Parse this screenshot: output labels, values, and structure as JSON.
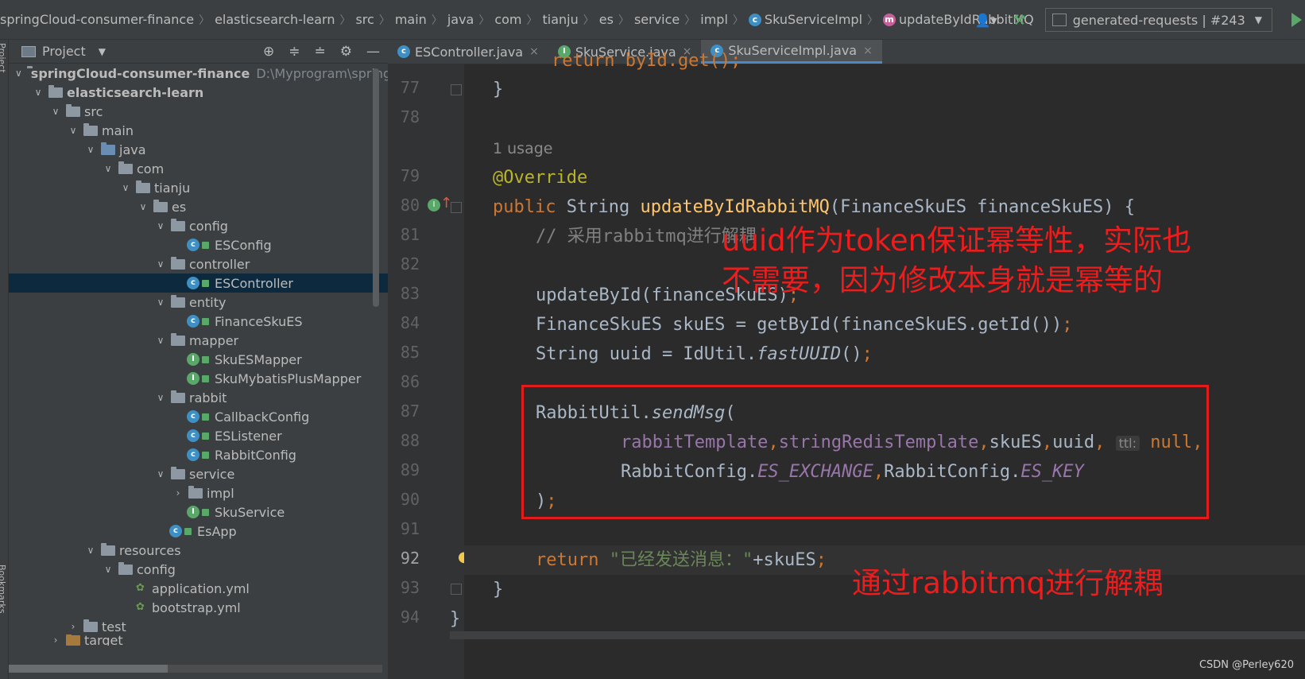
{
  "breadcrumbs": [
    "springCloud-consumer-finance",
    "elasticsearch-learn",
    "src",
    "main",
    "java",
    "com",
    "tianju",
    "es",
    "service",
    "impl",
    "SkuServiceImpl",
    "updateByIdRabbitMQ"
  ],
  "toolbar": {
    "run_config": "generated-requests | #243"
  },
  "left_stripe": {
    "project": "Project",
    "bookmarks": "Bookmarks"
  },
  "project_panel": {
    "title": "Project",
    "tree": [
      {
        "label": "springCloud-consumer-finance",
        "hint": "D:\\Myprogram\\springCl"
      },
      {
        "label": "elasticsearch-learn"
      },
      {
        "label": "src"
      },
      {
        "label": "main"
      },
      {
        "label": "java"
      },
      {
        "label": "com"
      },
      {
        "label": "tianju"
      },
      {
        "label": "es"
      },
      {
        "label": "config"
      },
      {
        "label": "ESConfig"
      },
      {
        "label": "controller"
      },
      {
        "label": "ESController"
      },
      {
        "label": "entity"
      },
      {
        "label": "FinanceSkuES"
      },
      {
        "label": "mapper"
      },
      {
        "label": "SkuESMapper"
      },
      {
        "label": "SkuMybatisPlusMapper"
      },
      {
        "label": "rabbit"
      },
      {
        "label": "CallbackConfig"
      },
      {
        "label": "ESListener"
      },
      {
        "label": "RabbitConfig"
      },
      {
        "label": "service"
      },
      {
        "label": "impl"
      },
      {
        "label": "SkuService"
      },
      {
        "label": "EsApp"
      },
      {
        "label": "resources"
      },
      {
        "label": "config"
      },
      {
        "label": "application.yml"
      },
      {
        "label": "bootstrap.yml"
      },
      {
        "label": "test"
      },
      {
        "label": "target"
      }
    ]
  },
  "tabs": [
    {
      "label": "ESController.java",
      "active": false
    },
    {
      "label": "SkuService.java",
      "active": false
    },
    {
      "label": "SkuServiceImpl.java",
      "active": true
    }
  ],
  "line_numbers": [
    "77",
    "78",
    "79",
    "80",
    "81",
    "82",
    "83",
    "84",
    "85",
    "86",
    "87",
    "88",
    "89",
    "90",
    "91",
    "92",
    "93",
    "94"
  ],
  "code": {
    "l76": "return byId.get();",
    "l77": "}",
    "usage": "1 usage",
    "l79": "@Override",
    "l80_kw": "public",
    "l80_type": " String ",
    "l80_fn": "updateByIdRabbitMQ",
    "l80_rest": "(FinanceSkuES financeSkuES) {",
    "l81": "// 采用rabbitmq进行解耦",
    "l83": "updateById(financeSkuES)",
    "l83_end": ";",
    "l84_a": "FinanceSkuES skuES = getById(financeSkuES.getId())",
    "l84_end": ";",
    "l85_a": "String uuid = IdUtil.",
    "l85_fn": "fastUUID",
    "l85_b": "()",
    "l85_end": ";",
    "l87_a": "RabbitUtil.",
    "l87_fn": "sendMsg",
    "l87_b": "(",
    "l88_f1": "rabbitTemplate",
    "l88_c1": ",",
    "l88_f2": "stringRedisTemplate",
    "l88_c2": ",",
    "l88_v": "skuES",
    "l88_c3": ",",
    "l88_v2": "uuid",
    "l88_c4": ",",
    "l88_hint": "ttl:",
    "l88_null": "null",
    "l88_c5": ",",
    "l89_a": "RabbitConfig.",
    "l89_k1": "ES_EXCHANGE",
    "l89_c": ",",
    "l89_b": "RabbitConfig.",
    "l89_k2": "ES_KEY",
    "l90_a": ")",
    "l90_end": ";",
    "l92_kw": "return",
    "l92_str": " \"已经发送消息：\"",
    "l92_rest": "+skuES",
    "l92_end": ";",
    "l93": "}",
    "l94": "}"
  },
  "annotations": {
    "note1_line1": "uuid作为token保证幂等性，实际也",
    "note1_line2": "不需要，因为修改本身就是幂等的",
    "note2": "通过rabbitmq进行解耦",
    "color": "#ee1c1c"
  },
  "watermark": "CSDN @Perley620"
}
